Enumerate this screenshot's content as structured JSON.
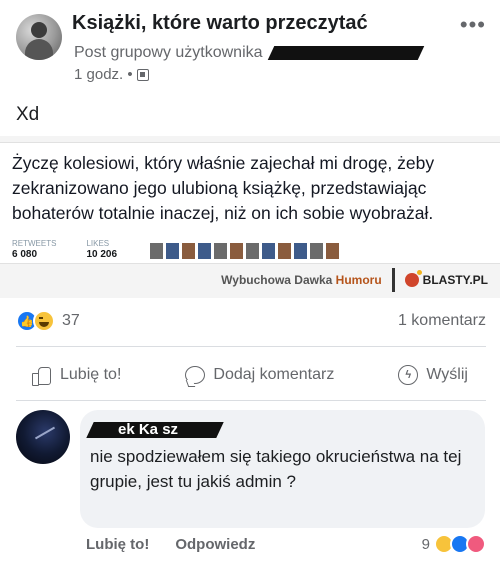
{
  "header": {
    "group_title": "Książki, które warto przeczytać",
    "post_type": "Post grupowy użytkownika",
    "time": "1 godz. •",
    "more_label": "•••"
  },
  "post": {
    "text": "Xd"
  },
  "meme": {
    "tweet_text": "Życzę kolesiowi, który właśnie zajechał mi drogę, żeby zekranizowano jego ulubioną książkę, przedstawiając bohaterów totalnie inaczej, niż on ich sobie wyobrażał.",
    "retweets_label": "RETWEETS",
    "retweets_value": "6 080",
    "likes_label": "LIKES",
    "likes_value": "10 206",
    "watermark_left_a": "Wybuchowa Dawka ",
    "watermark_left_b": "Humoru",
    "watermark_right": "BLASTY.PL"
  },
  "reactions": {
    "count": "37",
    "comments": "1 komentarz"
  },
  "actions": {
    "like": "Lubię to!",
    "comment": "Dodaj komentarz",
    "share": "Wyślij"
  },
  "comment": {
    "author_visible": "ek Ka sz",
    "text": "nie spodziewałem się takiego okrucieństwa na tej grupie, jest tu jakiś admin ?",
    "like_action": "Lubię to!",
    "reply_action": "Odpowiedz",
    "reaction_count": "9"
  },
  "colors": {
    "brand_blue": "#1877f2",
    "secondary_text": "#65676b",
    "bubble_bg": "#f0f2f5"
  }
}
